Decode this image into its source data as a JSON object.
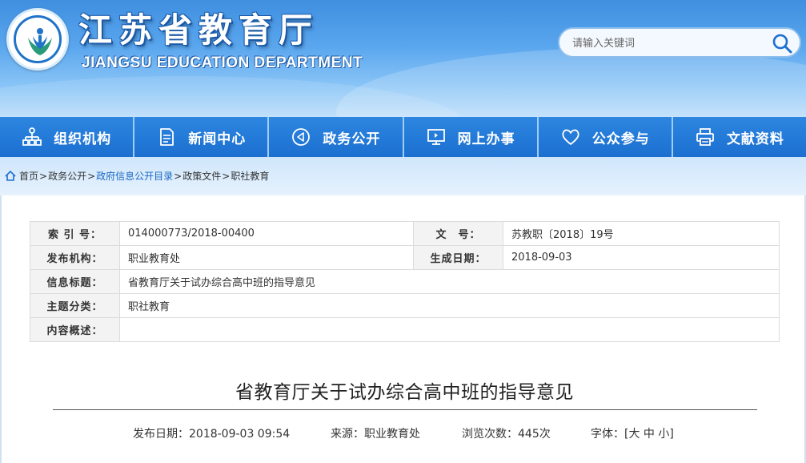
{
  "header": {
    "title": "江苏省教育厅",
    "subtitle": "JIANGSU EDUCATION DEPARTMENT",
    "search_placeholder": "请输入关键词"
  },
  "nav": {
    "items": [
      {
        "label": "组织机构",
        "icon": "org-chart-icon"
      },
      {
        "label": "新闻中心",
        "icon": "document-icon"
      },
      {
        "label": "政务公开",
        "icon": "megaphone-icon"
      },
      {
        "label": "网上办事",
        "icon": "monitor-icon"
      },
      {
        "label": "公众参与",
        "icon": "heart-icon"
      },
      {
        "label": "文献资料",
        "icon": "printer-icon"
      }
    ]
  },
  "breadcrumb": {
    "items": [
      "首页",
      "政务公开",
      "政府信息公开目录",
      "政策文件",
      "职社教育"
    ],
    "separator": ">"
  },
  "info": {
    "index_label": "索 引 号：",
    "index_value": "014000773/2018-00400",
    "docno_label": "文　号：",
    "docno_value": "苏教职〔2018〕19号",
    "org_label": "发布机构：",
    "org_value": "职业教育处",
    "date_label": "生成日期：",
    "date_value": "2018-09-03",
    "title_label": "信息标题：",
    "title_value": "省教育厅关于试办综合高中班的指导意见",
    "topic_label": "主题分类：",
    "topic_value": "职社教育",
    "summary_label": "内容概述：",
    "summary_value": ""
  },
  "article": {
    "title": "省教育厅关于试办综合高中班的指导意见",
    "publish": "发布日期：2018-09-03 09:54",
    "source": "来源：职业教育处",
    "views": "浏览次数：445次",
    "font_label": "字体：[",
    "font_large": "大",
    "font_medium": "中",
    "font_small": "小",
    "font_close": "]"
  },
  "colors": {
    "nav_bg": "#1c6fd0",
    "link_highlight": "#1a67c4",
    "label_bg": "#f3f3f3"
  }
}
